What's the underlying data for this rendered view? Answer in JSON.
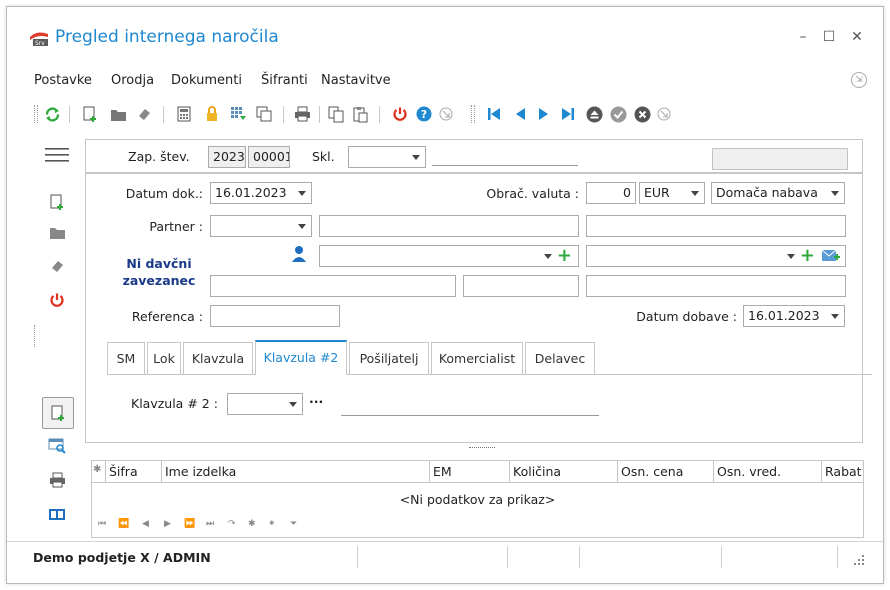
{
  "window": {
    "title": "Pregled internega naročila",
    "controls": {
      "minimize": "–",
      "maximize": "☐",
      "close": "✕"
    }
  },
  "menu": [
    "Postavke",
    "Orodja",
    "Dokumenti",
    "Šifranti",
    "Nastavitve"
  ],
  "header": {
    "zap_label": "Zap. štev.",
    "zap_year": "2023",
    "zap_number": "00001",
    "skl_label": "Skl.",
    "skl_value": ""
  },
  "form": {
    "datum_dok_label": "Datum dok.:",
    "datum_dok_value": "16.01.2023",
    "obrac_valuta_label": "Obrač. valuta :",
    "valuta_amount": "0",
    "valuta_currency": "EUR",
    "nabava_value": "Domača nabava",
    "partner_label": "Partner :",
    "ni_davcni_line1": "Ni davčni",
    "ni_davcni_line2": "zavezanec",
    "referenca_label": "Referenca :",
    "datum_dobave_label": "Datum dobave :",
    "datum_dobave_value": "16.01.2023"
  },
  "tabs": [
    {
      "label": "SM",
      "active": false
    },
    {
      "label": "Lok",
      "active": false
    },
    {
      "label": "Klavzula",
      "active": false
    },
    {
      "label": "Klavzula #2",
      "active": true
    },
    {
      "label": "Pošiljatelj",
      "active": false
    },
    {
      "label": "Komercialist",
      "active": false
    },
    {
      "label": "Delavec",
      "active": false
    }
  ],
  "tab_content": {
    "klavzula2_label": "Klavzula # 2 :",
    "ellipsis": "···"
  },
  "grid": {
    "columns": [
      "Šifra",
      "Ime izdelka",
      "EM",
      "Količina",
      "Osn. cena",
      "Osn. vred.",
      "Rabat"
    ],
    "empty_text": "<Ni podatkov za prikaz>",
    "nav": [
      "⏮",
      "⏪",
      "◀",
      "▶",
      "⏩",
      "⏭",
      "↷",
      "✱",
      "⁕",
      "⏷"
    ]
  },
  "status": {
    "text": "Demo podjetje X / ADMIN"
  },
  "colors": {
    "accent": "#1e88d1",
    "refresh": "#2eaa3b",
    "power": "#e0301e",
    "ni_davcni": "#1a3a8a"
  }
}
